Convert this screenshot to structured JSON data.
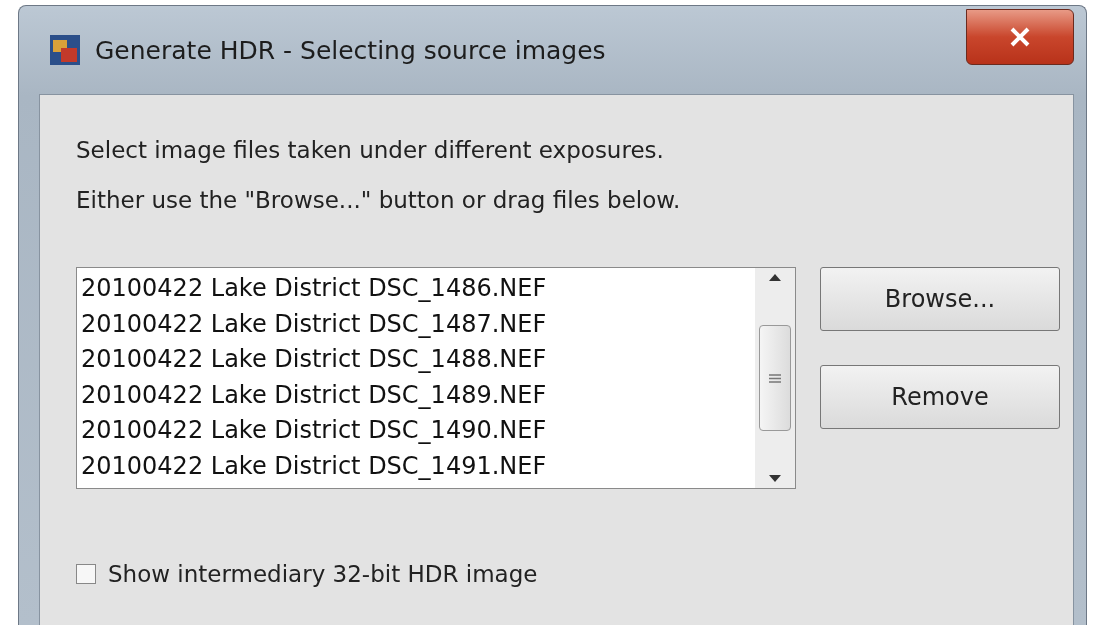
{
  "window": {
    "title": "Generate HDR - Selecting source images"
  },
  "instructions": [
    "Select image files taken under different exposures.",
    "Either use the \"Browse...\" button or drag files below."
  ],
  "files": [
    "20100422 Lake District DSC_1486.NEF",
    "20100422 Lake District DSC_1487.NEF",
    "20100422 Lake District DSC_1488.NEF",
    "20100422 Lake District DSC_1489.NEF",
    "20100422 Lake District DSC_1490.NEF",
    "20100422 Lake District DSC_1491.NEF"
  ],
  "buttons": [
    "Browse...",
    "Remove"
  ],
  "option": {
    "label": "Show intermediary 32-bit HDR image",
    "checked": false
  }
}
